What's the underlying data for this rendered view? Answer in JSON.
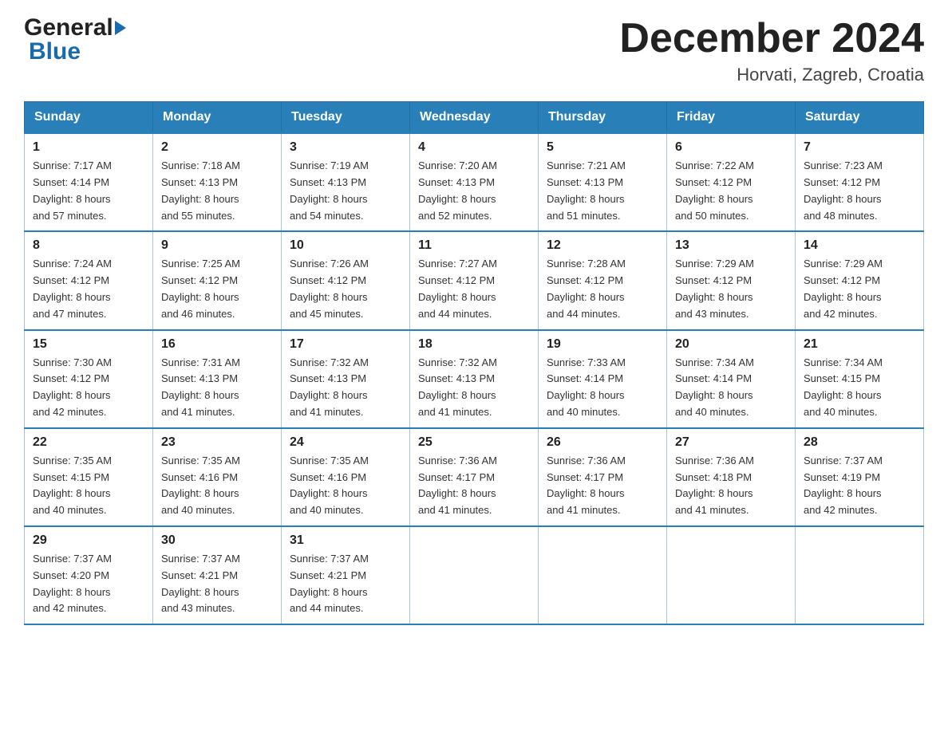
{
  "header": {
    "logo_general": "General",
    "logo_blue": "Blue",
    "month_title": "December 2024",
    "location": "Horvati, Zagreb, Croatia"
  },
  "columns": [
    "Sunday",
    "Monday",
    "Tuesday",
    "Wednesday",
    "Thursday",
    "Friday",
    "Saturday"
  ],
  "weeks": [
    [
      {
        "day": "1",
        "sunrise": "Sunrise: 7:17 AM",
        "sunset": "Sunset: 4:14 PM",
        "daylight": "Daylight: 8 hours",
        "daylight2": "and 57 minutes."
      },
      {
        "day": "2",
        "sunrise": "Sunrise: 7:18 AM",
        "sunset": "Sunset: 4:13 PM",
        "daylight": "Daylight: 8 hours",
        "daylight2": "and 55 minutes."
      },
      {
        "day": "3",
        "sunrise": "Sunrise: 7:19 AM",
        "sunset": "Sunset: 4:13 PM",
        "daylight": "Daylight: 8 hours",
        "daylight2": "and 54 minutes."
      },
      {
        "day": "4",
        "sunrise": "Sunrise: 7:20 AM",
        "sunset": "Sunset: 4:13 PM",
        "daylight": "Daylight: 8 hours",
        "daylight2": "and 52 minutes."
      },
      {
        "day": "5",
        "sunrise": "Sunrise: 7:21 AM",
        "sunset": "Sunset: 4:13 PM",
        "daylight": "Daylight: 8 hours",
        "daylight2": "and 51 minutes."
      },
      {
        "day": "6",
        "sunrise": "Sunrise: 7:22 AM",
        "sunset": "Sunset: 4:12 PM",
        "daylight": "Daylight: 8 hours",
        "daylight2": "and 50 minutes."
      },
      {
        "day": "7",
        "sunrise": "Sunrise: 7:23 AM",
        "sunset": "Sunset: 4:12 PM",
        "daylight": "Daylight: 8 hours",
        "daylight2": "and 48 minutes."
      }
    ],
    [
      {
        "day": "8",
        "sunrise": "Sunrise: 7:24 AM",
        "sunset": "Sunset: 4:12 PM",
        "daylight": "Daylight: 8 hours",
        "daylight2": "and 47 minutes."
      },
      {
        "day": "9",
        "sunrise": "Sunrise: 7:25 AM",
        "sunset": "Sunset: 4:12 PM",
        "daylight": "Daylight: 8 hours",
        "daylight2": "and 46 minutes."
      },
      {
        "day": "10",
        "sunrise": "Sunrise: 7:26 AM",
        "sunset": "Sunset: 4:12 PM",
        "daylight": "Daylight: 8 hours",
        "daylight2": "and 45 minutes."
      },
      {
        "day": "11",
        "sunrise": "Sunrise: 7:27 AM",
        "sunset": "Sunset: 4:12 PM",
        "daylight": "Daylight: 8 hours",
        "daylight2": "and 44 minutes."
      },
      {
        "day": "12",
        "sunrise": "Sunrise: 7:28 AM",
        "sunset": "Sunset: 4:12 PM",
        "daylight": "Daylight: 8 hours",
        "daylight2": "and 44 minutes."
      },
      {
        "day": "13",
        "sunrise": "Sunrise: 7:29 AM",
        "sunset": "Sunset: 4:12 PM",
        "daylight": "Daylight: 8 hours",
        "daylight2": "and 43 minutes."
      },
      {
        "day": "14",
        "sunrise": "Sunrise: 7:29 AM",
        "sunset": "Sunset: 4:12 PM",
        "daylight": "Daylight: 8 hours",
        "daylight2": "and 42 minutes."
      }
    ],
    [
      {
        "day": "15",
        "sunrise": "Sunrise: 7:30 AM",
        "sunset": "Sunset: 4:12 PM",
        "daylight": "Daylight: 8 hours",
        "daylight2": "and 42 minutes."
      },
      {
        "day": "16",
        "sunrise": "Sunrise: 7:31 AM",
        "sunset": "Sunset: 4:13 PM",
        "daylight": "Daylight: 8 hours",
        "daylight2": "and 41 minutes."
      },
      {
        "day": "17",
        "sunrise": "Sunrise: 7:32 AM",
        "sunset": "Sunset: 4:13 PM",
        "daylight": "Daylight: 8 hours",
        "daylight2": "and 41 minutes."
      },
      {
        "day": "18",
        "sunrise": "Sunrise: 7:32 AM",
        "sunset": "Sunset: 4:13 PM",
        "daylight": "Daylight: 8 hours",
        "daylight2": "and 41 minutes."
      },
      {
        "day": "19",
        "sunrise": "Sunrise: 7:33 AM",
        "sunset": "Sunset: 4:14 PM",
        "daylight": "Daylight: 8 hours",
        "daylight2": "and 40 minutes."
      },
      {
        "day": "20",
        "sunrise": "Sunrise: 7:34 AM",
        "sunset": "Sunset: 4:14 PM",
        "daylight": "Daylight: 8 hours",
        "daylight2": "and 40 minutes."
      },
      {
        "day": "21",
        "sunrise": "Sunrise: 7:34 AM",
        "sunset": "Sunset: 4:15 PM",
        "daylight": "Daylight: 8 hours",
        "daylight2": "and 40 minutes."
      }
    ],
    [
      {
        "day": "22",
        "sunrise": "Sunrise: 7:35 AM",
        "sunset": "Sunset: 4:15 PM",
        "daylight": "Daylight: 8 hours",
        "daylight2": "and 40 minutes."
      },
      {
        "day": "23",
        "sunrise": "Sunrise: 7:35 AM",
        "sunset": "Sunset: 4:16 PM",
        "daylight": "Daylight: 8 hours",
        "daylight2": "and 40 minutes."
      },
      {
        "day": "24",
        "sunrise": "Sunrise: 7:35 AM",
        "sunset": "Sunset: 4:16 PM",
        "daylight": "Daylight: 8 hours",
        "daylight2": "and 40 minutes."
      },
      {
        "day": "25",
        "sunrise": "Sunrise: 7:36 AM",
        "sunset": "Sunset: 4:17 PM",
        "daylight": "Daylight: 8 hours",
        "daylight2": "and 41 minutes."
      },
      {
        "day": "26",
        "sunrise": "Sunrise: 7:36 AM",
        "sunset": "Sunset: 4:17 PM",
        "daylight": "Daylight: 8 hours",
        "daylight2": "and 41 minutes."
      },
      {
        "day": "27",
        "sunrise": "Sunrise: 7:36 AM",
        "sunset": "Sunset: 4:18 PM",
        "daylight": "Daylight: 8 hours",
        "daylight2": "and 41 minutes."
      },
      {
        "day": "28",
        "sunrise": "Sunrise: 7:37 AM",
        "sunset": "Sunset: 4:19 PM",
        "daylight": "Daylight: 8 hours",
        "daylight2": "and 42 minutes."
      }
    ],
    [
      {
        "day": "29",
        "sunrise": "Sunrise: 7:37 AM",
        "sunset": "Sunset: 4:20 PM",
        "daylight": "Daylight: 8 hours",
        "daylight2": "and 42 minutes."
      },
      {
        "day": "30",
        "sunrise": "Sunrise: 7:37 AM",
        "sunset": "Sunset: 4:21 PM",
        "daylight": "Daylight: 8 hours",
        "daylight2": "and 43 minutes."
      },
      {
        "day": "31",
        "sunrise": "Sunrise: 7:37 AM",
        "sunset": "Sunset: 4:21 PM",
        "daylight": "Daylight: 8 hours",
        "daylight2": "and 44 minutes."
      },
      null,
      null,
      null,
      null
    ]
  ]
}
